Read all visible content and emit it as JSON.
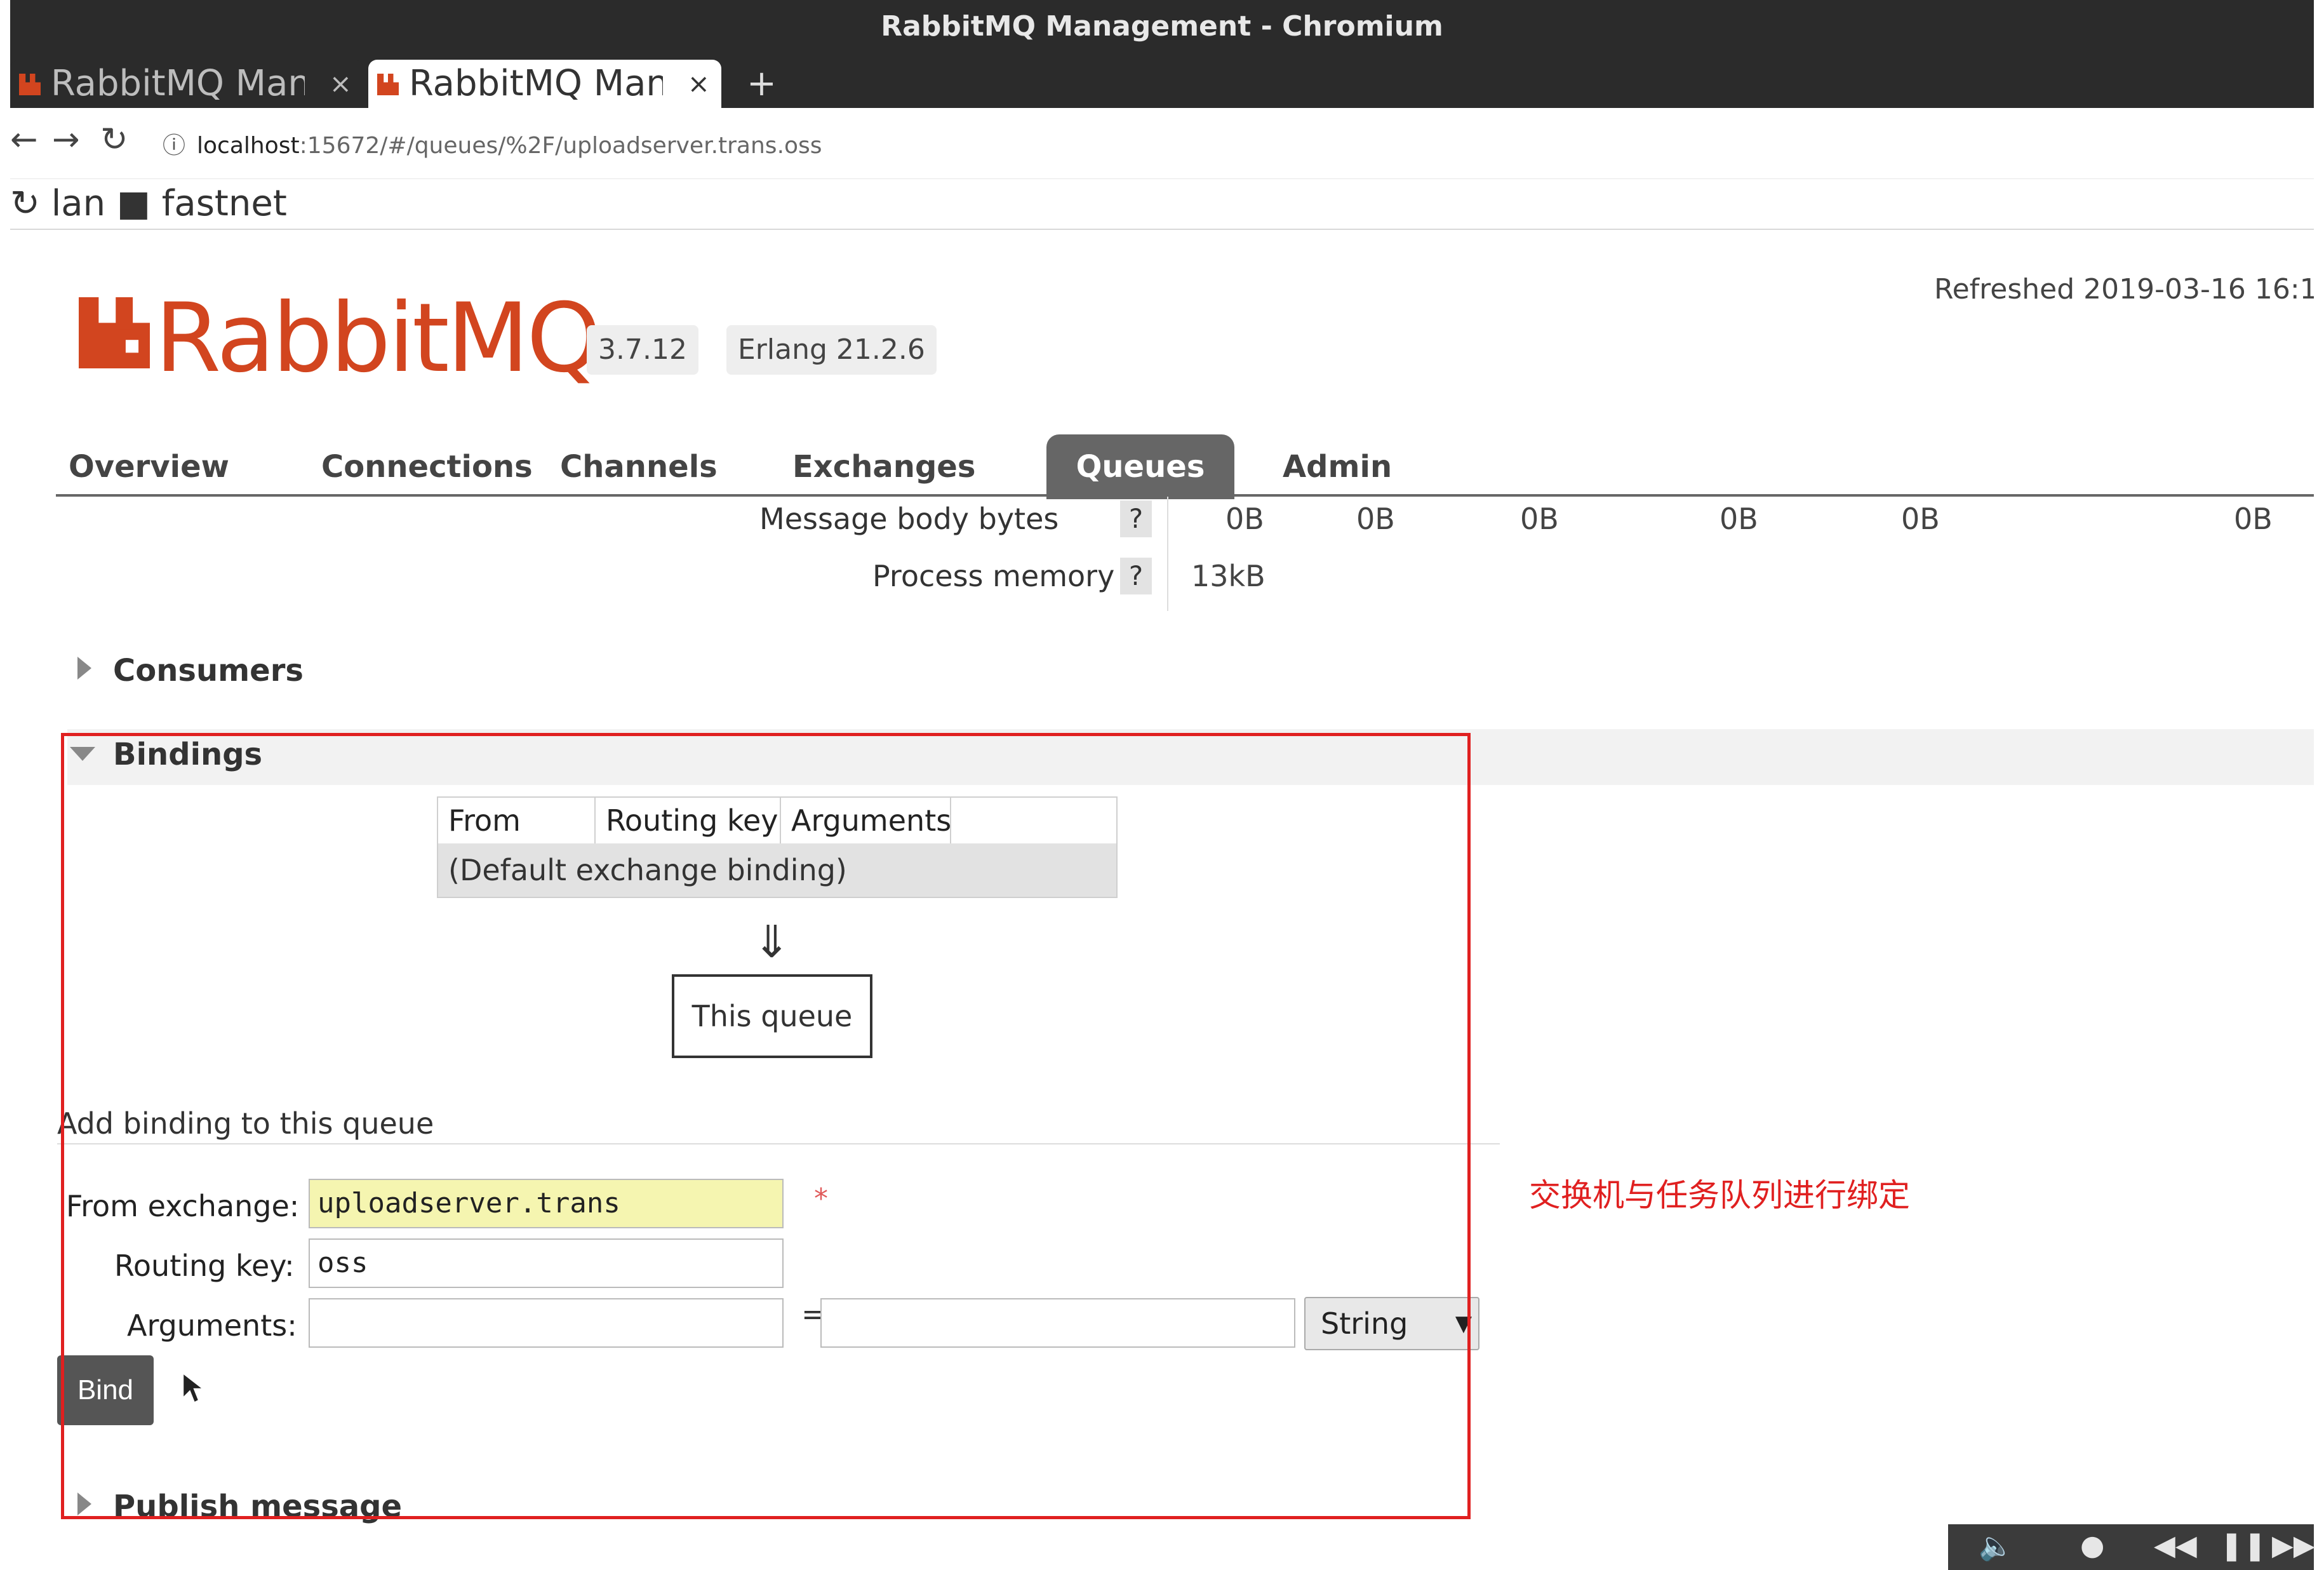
{
  "window": {
    "title": "RabbitMQ Management - Chromium"
  },
  "browser": {
    "tabs": [
      {
        "label": "RabbitMQ Mana",
        "close": "×"
      },
      {
        "label": "RabbitMQ Mana",
        "close": "×"
      }
    ],
    "new_tab": "+",
    "url": {
      "info": "ⓘ",
      "host": "localhost",
      "path": ":15672/#/queues/%2F/uploadserver.trans.oss"
    },
    "bookmarks": [
      "lan",
      "fastnet"
    ]
  },
  "header": {
    "brand": "RabbitMQ",
    "version": "3.7.12",
    "erlang": "Erlang 21.2.6",
    "refreshed": "Refreshed 2019-03-16 16:1"
  },
  "menu": [
    "Overview",
    "Connections",
    "Channels",
    "Exchanges",
    "Queues",
    "Admin"
  ],
  "active_menu": "Queues",
  "stats": {
    "message_body_bytes": {
      "label": "Message body bytes",
      "help": "?",
      "values": [
        "0B",
        "0B",
        "0B",
        "0B",
        "0B",
        "0B"
      ]
    },
    "process_memory": {
      "label": "Process memory",
      "help": "?",
      "value": "13kB"
    }
  },
  "sections": {
    "consumers": "Consumers",
    "bindings": "Bindings",
    "publish": "Publish message"
  },
  "bindings": {
    "headers": [
      "From",
      "Routing key",
      "Arguments"
    ],
    "default_row": "(Default exchange binding)",
    "arrow": "⇓",
    "this_queue": "This queue"
  },
  "add_binding": {
    "title": "Add binding to this queue",
    "from_exchange_label": "From exchange:",
    "from_exchange_value": "uploadserver.trans",
    "required_mark": "*",
    "routing_key_label": "Routing key:",
    "routing_key_value": "oss",
    "arguments_label": "Arguments:",
    "equals": "=",
    "type_selected": "String",
    "bind_button": "Bind"
  },
  "annotation": "交换机与任务队列进行绑定",
  "colors": {
    "brand": "#d2451f",
    "annotation": "#e02020",
    "active_tab": "#666666"
  }
}
